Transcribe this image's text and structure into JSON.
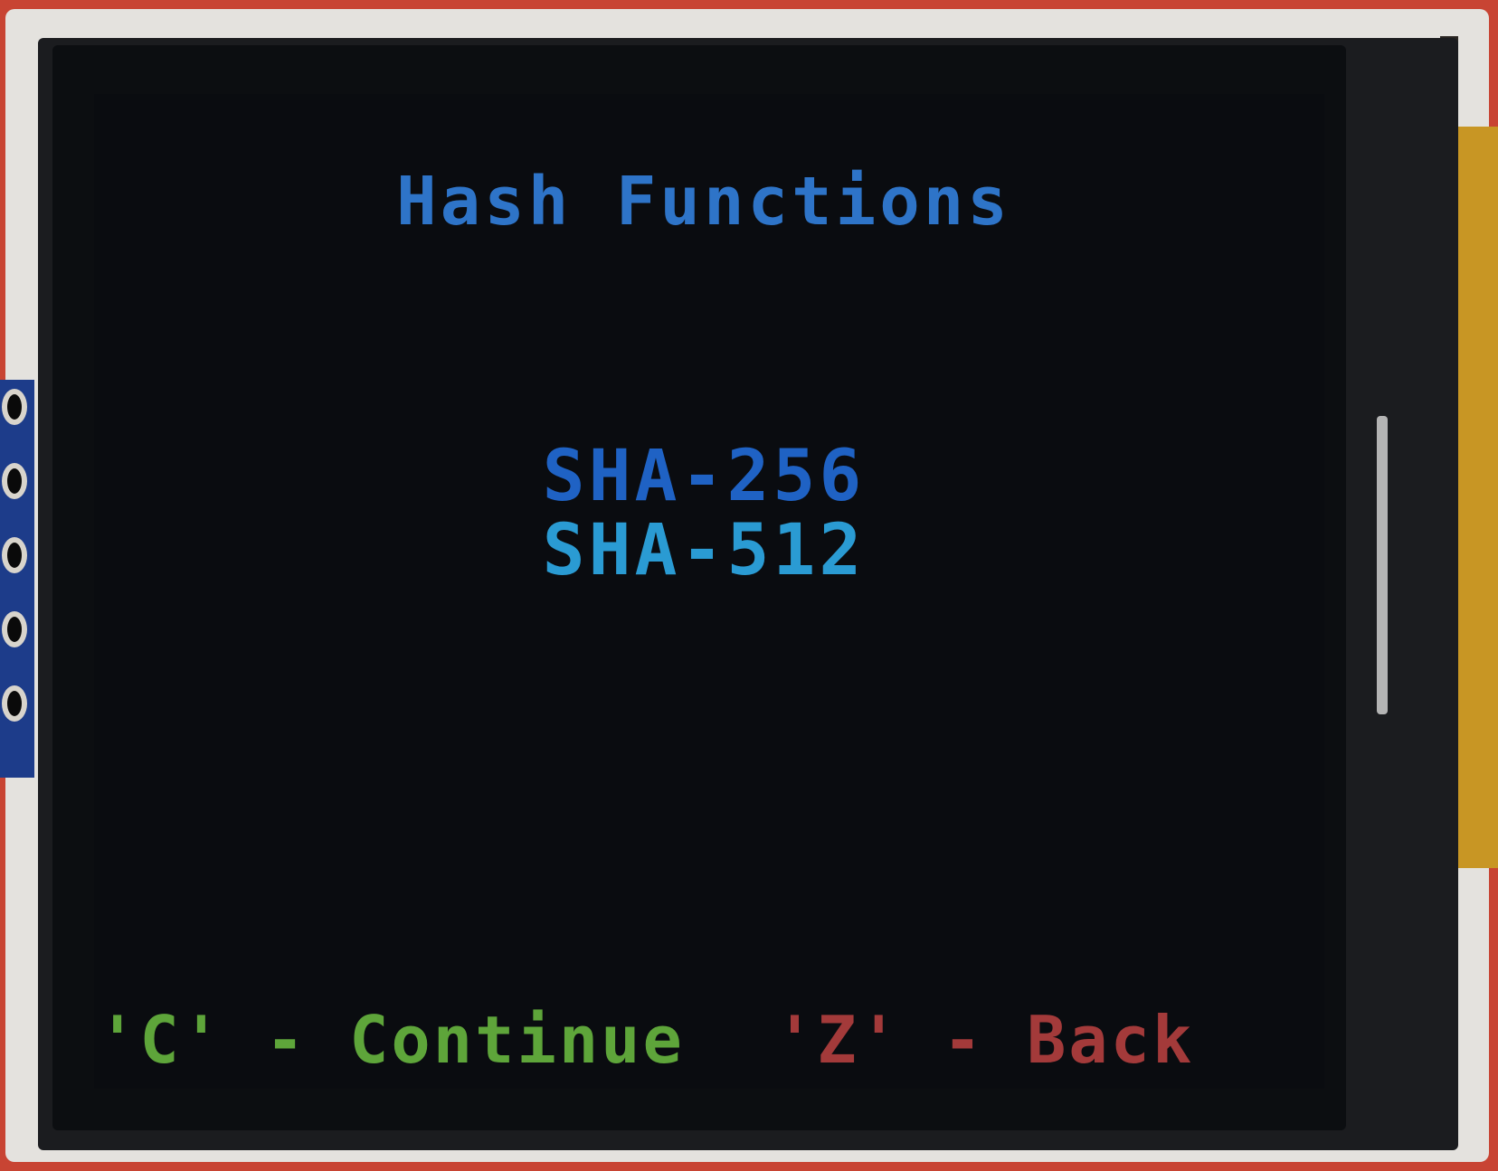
{
  "screen": {
    "title": "Hash Functions",
    "menu": {
      "items": [
        {
          "label": "SHA-256",
          "selected": true
        },
        {
          "label": "SHA-512",
          "selected": false
        }
      ]
    },
    "footer": {
      "continue_hint": "'C' - Continue",
      "back_hint": "'Z' - Back"
    }
  },
  "colors": {
    "title": "#2e74c8",
    "selected_item": "#1f62c4",
    "item": "#2a9bd3",
    "continue": "#5ea53a",
    "back": "#a33a3a",
    "background": "#0a0c10"
  }
}
